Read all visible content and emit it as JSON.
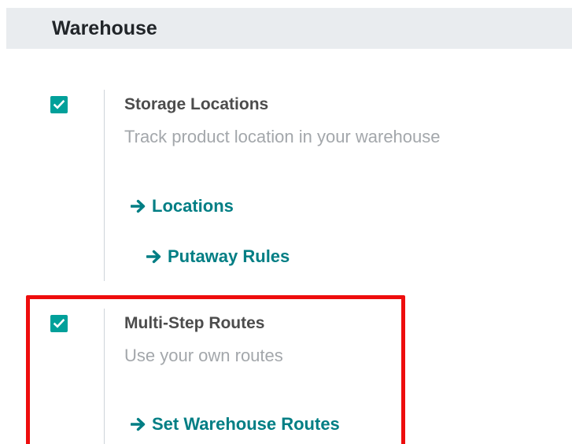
{
  "section": {
    "title": "Warehouse"
  },
  "settings": [
    {
      "checked": true,
      "title": "Storage Locations",
      "description": "Track product location in your warehouse",
      "links": [
        "Locations",
        "Putaway Rules"
      ]
    },
    {
      "checked": true,
      "title": "Multi-Step Routes",
      "description": "Use your own routes",
      "links": [
        "Set Warehouse Routes"
      ],
      "highlighted": true
    }
  ],
  "colors": {
    "accent": "#017e84",
    "checkbox": "#01a09a",
    "highlight": "#ee0d0d",
    "header_bg": "#e9ecef"
  },
  "icons": {
    "checkbox": "checkmark-icon",
    "link": "arrow-right-icon"
  }
}
